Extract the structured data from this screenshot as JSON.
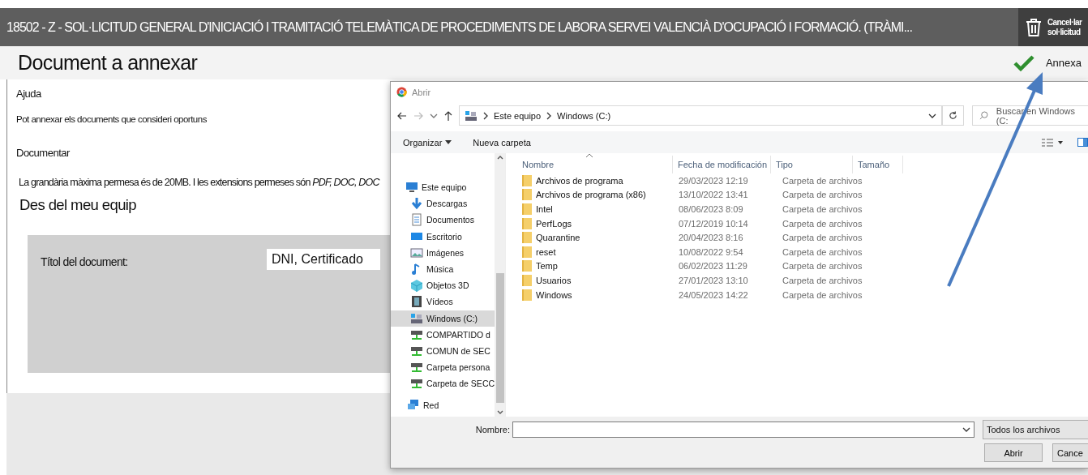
{
  "title_bar": {
    "title": "18502 - Z - SOL·LICITUD GENERAL D'INICIACIÓ I TRAMITACIÓ TELEMÀTICA DE PROCEDIMENTS DE LABORA SERVEI VALENCIÀ D'OCUPACIÓ I FORMACIÓ. (TRÀMI...",
    "cancel_button": "Cancel·lar sol·licitud"
  },
  "header": {
    "title": "Document a annexar",
    "annex_button": "Annexa"
  },
  "help": {
    "heading": "Ajuda",
    "text": "Pot annexar els documents que consideri oportuns"
  },
  "document": {
    "heading": "Documentar",
    "note": "La grandària màxima permesa és de 20MB. I les extensions permeses són *PDF, DOC, DOC*",
    "source": "Des del meu equip",
    "title_label": "Títol del document:",
    "title_value": "DNI, Certificado"
  },
  "file_dialog": {
    "title": "Abrir",
    "breadcrumb": [
      "Este equipo",
      "Windows (C:)"
    ],
    "search_placeholder": "Buscar en Windows (C:",
    "toolbar": [
      {
        "label": "Organizar",
        "kind": "menu"
      },
      {
        "label": "Nueva carpeta",
        "kind": "button"
      }
    ],
    "nav_items": [
      {
        "label": "Este equipo",
        "kind": "pc",
        "selected": false
      },
      {
        "label": "Descargas",
        "kind": "downloads",
        "selected": false
      },
      {
        "label": "Documentos",
        "kind": "documents",
        "selected": false
      },
      {
        "label": "Escritorio",
        "kind": "desktop",
        "selected": false
      },
      {
        "label": "Imágenes",
        "kind": "pictures",
        "selected": false
      },
      {
        "label": "Música",
        "kind": "music",
        "selected": false
      },
      {
        "label": "Objetos 3D",
        "kind": "objects",
        "selected": false
      },
      {
        "label": "Vídeos",
        "kind": "videos",
        "selected": false
      },
      {
        "label": "Windows (C:)",
        "kind": "drive",
        "selected": true
      },
      {
        "label": "COMPARTIDO d",
        "kind": "netdrive",
        "selected": false
      },
      {
        "label": "COMUN de SEC",
        "kind": "netdrive",
        "selected": false
      },
      {
        "label": "Carpeta persona",
        "kind": "netdrive",
        "selected": false
      },
      {
        "label": "Carpeta de SECC",
        "kind": "netdrive",
        "selected": false
      },
      {
        "label": "Red",
        "kind": "network",
        "selected": false
      }
    ],
    "columns": [
      {
        "label": "Nombre",
        "sorted": true
      },
      {
        "label": "Fecha de modificación",
        "sorted": false
      },
      {
        "label": "Tipo",
        "sorted": false
      },
      {
        "label": "Tamaño",
        "sorted": false
      }
    ],
    "rows": [
      {
        "name": "Archivos de programa",
        "date": "29/03/2023 12:19",
        "type": "Carpeta de archivos"
      },
      {
        "name": "Archivos de programa (x86)",
        "date": "13/10/2022 13:41",
        "type": "Carpeta de archivos"
      },
      {
        "name": "Intel",
        "date": "08/06/2023 8:09",
        "type": "Carpeta de archivos"
      },
      {
        "name": "PerfLogs",
        "date": "07/12/2019 10:14",
        "type": "Carpeta de archivos"
      },
      {
        "name": "Quarantine",
        "date": "20/04/2023 8:16",
        "type": "Carpeta de archivos"
      },
      {
        "name": "reset",
        "date": "10/08/2022 9:54",
        "type": "Carpeta de archivos"
      },
      {
        "name": "Temp",
        "date": "06/02/2023 11:29",
        "type": "Carpeta de archivos"
      },
      {
        "name": "Usuarios",
        "date": "27/01/2023 13:10",
        "type": "Carpeta de archivos"
      },
      {
        "name": "Windows",
        "date": "24/05/2023 14:22",
        "type": "Carpeta de archivos"
      }
    ],
    "filename_label": "Nombre:",
    "filter": "Todos los archivos",
    "buttons": [
      "Abrir",
      "Cance"
    ]
  }
}
